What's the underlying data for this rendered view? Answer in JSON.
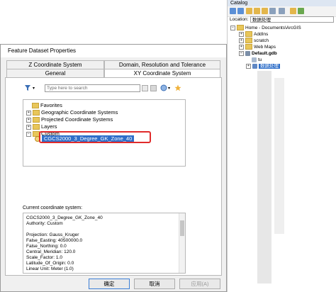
{
  "catalog": {
    "title": "Catalog",
    "location_label": "Location:",
    "location_value": "数据处理",
    "tree": [
      {
        "label": "Home - Documents\\ArcGIS",
        "icon": "folder-icon",
        "expander": "−"
      },
      {
        "label": "AddIns",
        "icon": "folder-icon",
        "expander": "+"
      },
      {
        "label": "scratch",
        "icon": "folder-icon",
        "expander": "+"
      },
      {
        "label": "Web Maps",
        "icon": "folder-icon",
        "expander": "+"
      },
      {
        "label": "Default.gdb",
        "icon": "geodatabase-icon",
        "expander": "−"
      },
      {
        "label": "tu",
        "icon": "feature-class-icon",
        "expander": ""
      },
      {
        "label": "数据处理",
        "icon": "feature-dataset-icon",
        "expander": "+"
      }
    ]
  },
  "dialog": {
    "title": "Feature Dataset Properties",
    "tabs": [
      {
        "label": "Z Coordinate System",
        "active": false
      },
      {
        "label": "Domain, Resolution and Tolerance",
        "active": false
      },
      {
        "label": "General",
        "active": false
      },
      {
        "label": "XY Coordinate System",
        "active": true
      }
    ],
    "search_placeholder": "Type here to search",
    "tree": [
      {
        "label": "Favorites",
        "expander": ""
      },
      {
        "label": "Geographic Coordinate Systems",
        "expander": "+"
      },
      {
        "label": "Projected Coordinate Systems",
        "expander": "+"
      },
      {
        "label": "Layers",
        "expander": "+"
      },
      {
        "label": "Custom",
        "expander": "−"
      }
    ],
    "selected_item": "CGCS2000_3_Degree_GK_Zone_40",
    "current_label": "Current coordinate system:",
    "current_lines": [
      "CGCS2000_3_Degree_GK_Zone_40",
      "Authority: Custom",
      "",
      "Projection: Gauss_Kruger",
      "False_Easting: 40500000.0",
      "False_Northing: 0.0",
      "Central_Meridian: 120.0",
      "Scale_Factor: 1.0",
      "Latitude_Of_Origin: 0.0",
      "Linear Unit: Meter (1.0)"
    ],
    "buttons": {
      "ok": "确定",
      "cancel": "取消",
      "apply": "应用(A)"
    }
  },
  "colors": {
    "selection": "#2f6fc9",
    "highlight_box": "#e02b2b"
  }
}
